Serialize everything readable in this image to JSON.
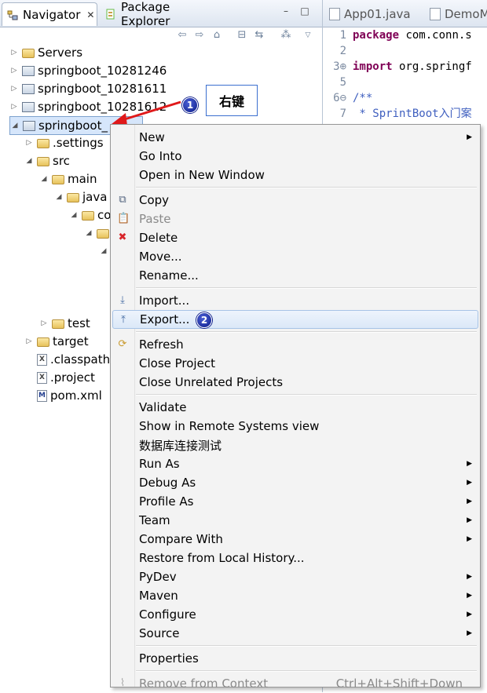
{
  "navigator": {
    "tabs": [
      {
        "label": "Navigator",
        "close": "✕"
      },
      {
        "label": "Package Explorer"
      }
    ],
    "window_buttons": [
      "–",
      "□"
    ],
    "toolbar_icons": [
      "back-icon",
      "forward-icon",
      "home-icon",
      "collapse-all-icon",
      "link-editor-icon",
      "filters-icon",
      "view-menu-icon"
    ],
    "tree": [
      {
        "label": "Servers",
        "level": 0,
        "twisty": "▷",
        "icon": "folder"
      },
      {
        "label": "springboot_10281246",
        "level": 0,
        "twisty": "▷",
        "icon": "project"
      },
      {
        "label": "springboot_10281611",
        "level": 0,
        "twisty": "▷",
        "icon": "project"
      },
      {
        "label": "springboot_10281612",
        "level": 0,
        "twisty": "▷",
        "icon": "project"
      },
      {
        "label": "springboot_",
        "level": 0,
        "twisty": "◢",
        "icon": "project",
        "selected": true
      },
      {
        "label": ".settings",
        "level": 1,
        "twisty": "▷",
        "icon": "folder"
      },
      {
        "label": "src",
        "level": 1,
        "twisty": "◢",
        "icon": "folder"
      },
      {
        "label": "main",
        "level": 2,
        "twisty": "◢",
        "icon": "folder"
      },
      {
        "label": "java",
        "level": 3,
        "twisty": "◢",
        "icon": "folder"
      },
      {
        "label": "co",
        "level": 4,
        "twisty": "◢",
        "icon": "folder"
      },
      {
        "label": "",
        "level": 5,
        "twisty": "◢",
        "icon": "folder"
      },
      {
        "label": "",
        "level": 6,
        "twisty": "◢",
        "icon": "none"
      },
      {
        "label": "test",
        "level": 2,
        "twisty": "▷",
        "icon": "folder",
        "row": 15
      },
      {
        "label": "target",
        "level": 1,
        "twisty": "▷",
        "icon": "folder"
      },
      {
        "label": ".classpath",
        "level": 1,
        "twisty": "",
        "icon": "xfile"
      },
      {
        "label": ".project",
        "level": 1,
        "twisty": "",
        "icon": "xfile"
      },
      {
        "label": "pom.xml",
        "level": 1,
        "twisty": "",
        "icon": "mfile"
      }
    ]
  },
  "editor": {
    "tabs": [
      {
        "label": "App01.java"
      },
      {
        "label": "DemoM"
      }
    ],
    "lines": [
      {
        "num": "1",
        "parts": [
          {
            "t": "package",
            "c": "kw"
          },
          {
            "t": " com.conn.s",
            "c": ""
          }
        ]
      },
      {
        "num": "2",
        "parts": []
      },
      {
        "num": "3⊕",
        "parts": [
          {
            "t": "import",
            "c": "kw"
          },
          {
            "t": " org.springf",
            "c": ""
          }
        ]
      },
      {
        "num": "5",
        "parts": []
      },
      {
        "num": "6⊖",
        "parts": [
          {
            "t": "/**",
            "c": "cm"
          }
        ]
      },
      {
        "num": "7",
        "parts": [
          {
            "t": " * SprintBoot入门案",
            "c": "cm"
          }
        ]
      }
    ]
  },
  "annotations": {
    "callout_label": "右键",
    "badge1": "1",
    "badge2": "2"
  },
  "context_menu": {
    "items": [
      {
        "type": "item",
        "label": "New",
        "submenu": true
      },
      {
        "type": "item",
        "label": "Go Into"
      },
      {
        "type": "item",
        "label": "Open in New Window"
      },
      {
        "type": "sep"
      },
      {
        "type": "item",
        "label": "Copy",
        "icon": "copy-icon"
      },
      {
        "type": "item",
        "label": "Paste",
        "icon": "paste-icon",
        "disabled": true
      },
      {
        "type": "item",
        "label": "Delete",
        "icon": "delete-icon"
      },
      {
        "type": "item",
        "label": "Move..."
      },
      {
        "type": "item",
        "label": "Rename..."
      },
      {
        "type": "sep"
      },
      {
        "type": "item",
        "label": "Import...",
        "icon": "import-icon"
      },
      {
        "type": "item",
        "label": "Export...",
        "icon": "export-icon",
        "highlighted": true
      },
      {
        "type": "sep"
      },
      {
        "type": "item",
        "label": "Refresh",
        "icon": "refresh-icon"
      },
      {
        "type": "item",
        "label": "Close Project"
      },
      {
        "type": "item",
        "label": "Close Unrelated Projects"
      },
      {
        "type": "sep"
      },
      {
        "type": "item",
        "label": "Validate"
      },
      {
        "type": "item",
        "label": "Show in Remote Systems view"
      },
      {
        "type": "item",
        "label": "数据库连接测试"
      },
      {
        "type": "item",
        "label": "Run As",
        "submenu": true
      },
      {
        "type": "item",
        "label": "Debug As",
        "submenu": true
      },
      {
        "type": "item",
        "label": "Profile As",
        "submenu": true
      },
      {
        "type": "item",
        "label": "Team",
        "submenu": true
      },
      {
        "type": "item",
        "label": "Compare With",
        "submenu": true
      },
      {
        "type": "item",
        "label": "Restore from Local History..."
      },
      {
        "type": "item",
        "label": "PyDev",
        "submenu": true
      },
      {
        "type": "item",
        "label": "Maven",
        "submenu": true
      },
      {
        "type": "item",
        "label": "Configure",
        "submenu": true
      },
      {
        "type": "item",
        "label": "Source",
        "submenu": true
      },
      {
        "type": "sep"
      },
      {
        "type": "item",
        "label": "Properties"
      },
      {
        "type": "sep"
      },
      {
        "type": "item",
        "label": "Remove from Context",
        "icon": "remove-context-icon",
        "disabled": true,
        "accel": "Ctrl+Alt+Shift+Down"
      }
    ]
  },
  "colors": {
    "selection": "#d6e6fb",
    "menu_bg": "#f3f3f3",
    "arrow": "#e0191a",
    "badge": "#0d1d88",
    "keyword": "#7f0055",
    "comment": "#3f5fbf"
  }
}
